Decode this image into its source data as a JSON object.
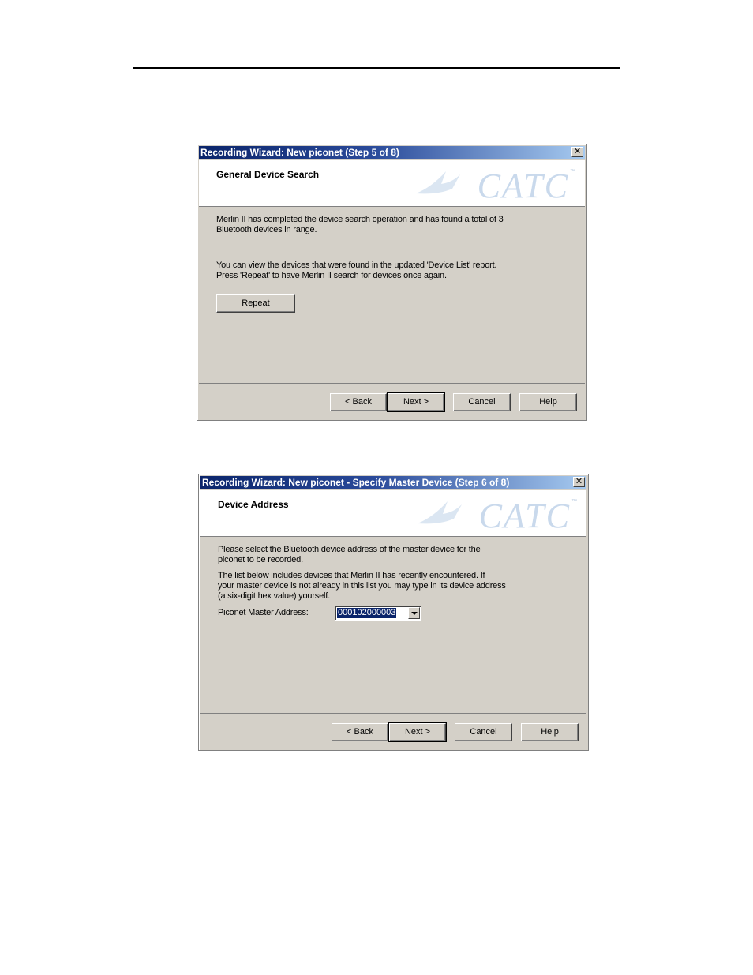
{
  "dialog1": {
    "title": "Recording Wizard: New piconet (Step  5 of 8)",
    "close": "✕",
    "header": "General Device Search",
    "logo": "CATC",
    "logo_tm": "™",
    "text1_line1": "Merlin II  has completed the device search operation and has found a total of 3",
    "text1_line2": "Bluetooth devices in range.",
    "text2_line1": "You can view the devices that were found in the updated 'Device List' report.",
    "text2_line2": "Press 'Repeat' to have Merlin II search for devices once again.",
    "repeat_label": "Repeat",
    "back_label": "< Back",
    "next_label": "Next >",
    "cancel_label": "Cancel",
    "help_label": "Help"
  },
  "dialog2": {
    "title": "Recording Wizard: New piconet - Specify Master Device (Step 6 of 8)",
    "close": "✕",
    "header": "Device Address",
    "logo": "CATC",
    "logo_tm": "™",
    "text1_line1": "Please select the Bluetooth device address of the master device for the",
    "text1_line2": "piconet to be recorded.",
    "text2_line1": "The list below includes devices that Merlin II  has recently encountered.  If",
    "text2_line2": "your master device is not already in this list you may type in its device address",
    "text2_line3": "(a six-digit hex value) yourself.",
    "address_label": "Piconet Master Address:",
    "address_value": "000102000003",
    "back_label": "< Back",
    "next_label": "Next >",
    "cancel_label": "Cancel",
    "help_label": "Help"
  }
}
